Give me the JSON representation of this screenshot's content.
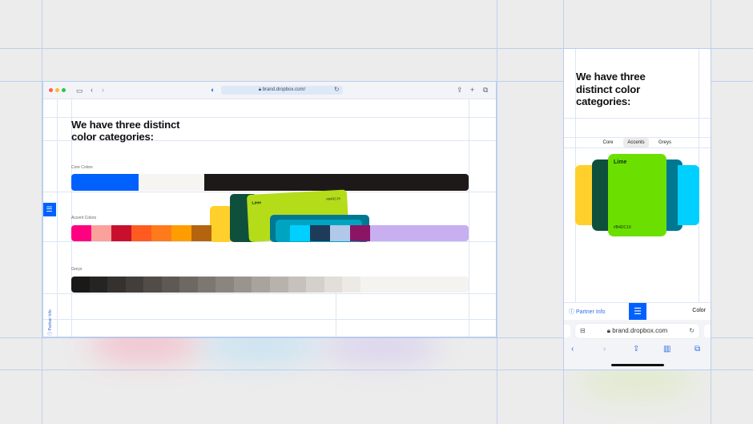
{
  "desktop": {
    "url": "brand.dropbox.com/",
    "heading_line1": "We have three distinct",
    "heading_line2": "color categories:",
    "core_label": "Core Colors",
    "accent_label": "Accent Colors",
    "greys_label": "Greys",
    "partner_info": "Partner Info",
    "lime_card_name": "Lime",
    "lime_card_hex": "#B4DC19",
    "core_colors": [
      "#0061FE",
      "#F7F5F2",
      "#1E1919"
    ],
    "accent_colors": [
      "#FF0080",
      "#FAA19B",
      "#C8102E",
      "#FF5A1F",
      "#FF7A1A",
      "#FF9D00",
      "#B4640F",
      "#FFD02B",
      "#0F503C",
      "#B4DC19",
      "#007891",
      "#00D0FF",
      "#1E3C5A",
      "#B0C9E8",
      "#8C1464",
      "#C8AFF0"
    ],
    "greys": [
      "#1A1918",
      "#262422",
      "#34312E",
      "#423E3B",
      "#514C48",
      "#5F5955",
      "#6E6863",
      "#7D7772",
      "#8B8580",
      "#9A948F",
      "#A9A39E",
      "#B8B2AD",
      "#C6C1BC",
      "#D4D0CB",
      "#E2DED9",
      "#EDEAE6",
      "#F5F3F0"
    ]
  },
  "mobile": {
    "heading_line1": "We have three",
    "heading_line2": "distinct color",
    "heading_line3": "categories:",
    "tabs": [
      "Core",
      "Accents",
      "Greys"
    ],
    "active_tab": "Accents",
    "card_name": "Lime",
    "card_hex": "#B4DC19",
    "partner_info": "Partner Info",
    "right_label": "Color",
    "url": "brand.dropbox.com"
  },
  "icons": [
    "sidebar-icon",
    "back-icon",
    "forward-icon",
    "shield-icon",
    "lock-icon",
    "reload-icon",
    "share-icon",
    "plus-icon",
    "tabs-icon",
    "menu-icon",
    "info-icon",
    "bookmarks-icon"
  ]
}
